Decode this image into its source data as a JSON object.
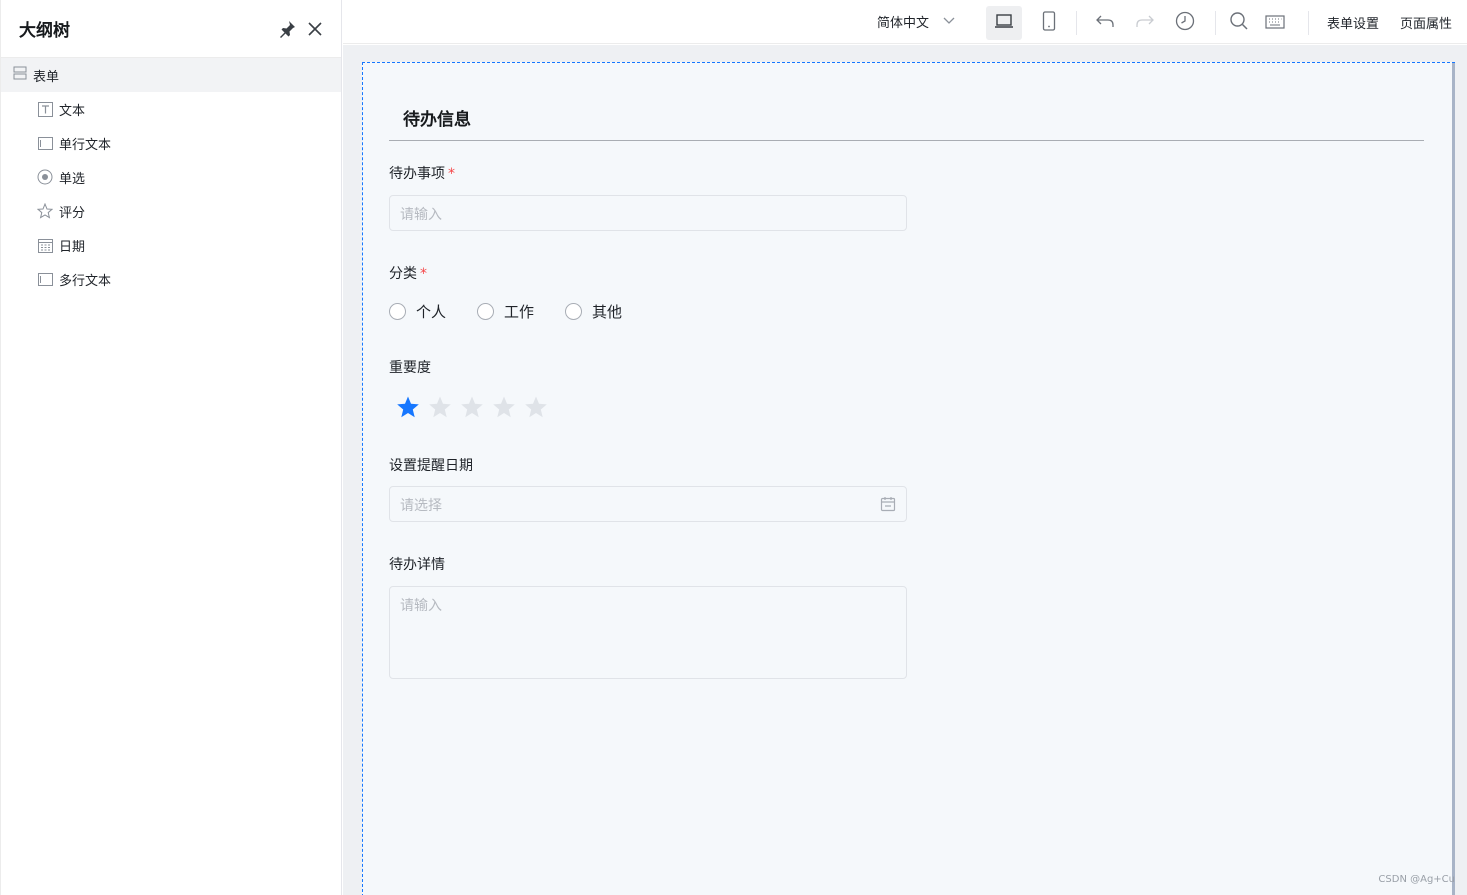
{
  "sidebar": {
    "title": "大纲树",
    "root": "表单",
    "items": [
      {
        "label": "文本",
        "icon": "text-icon"
      },
      {
        "label": "单行文本",
        "icon": "input-icon"
      },
      {
        "label": "单选",
        "icon": "radio-icon"
      },
      {
        "label": "评分",
        "icon": "star-icon"
      },
      {
        "label": "日期",
        "icon": "calendar-icon"
      },
      {
        "label": "多行文本",
        "icon": "textarea-icon"
      }
    ]
  },
  "toolbar": {
    "language": "简体中文",
    "form_settings": "表单设置",
    "page_properties": "页面属性"
  },
  "form": {
    "section_title": "待办信息",
    "todo_item": {
      "label": "待办事项",
      "required": "*",
      "placeholder": "请输入"
    },
    "category": {
      "label": "分类",
      "required": "*",
      "options": [
        "个人",
        "工作",
        "其他"
      ]
    },
    "importance": {
      "label": "重要度",
      "rating": 1,
      "max": 5
    },
    "reminder_date": {
      "label": "设置提醒日期",
      "placeholder": "请选择"
    },
    "details": {
      "label": "待办详情",
      "placeholder": "请输入"
    }
  },
  "colors": {
    "accent": "#1677ff",
    "required": "#f5474a",
    "star_empty": "#dfe3e8"
  },
  "watermark": "CSDN @Ag+Cu"
}
